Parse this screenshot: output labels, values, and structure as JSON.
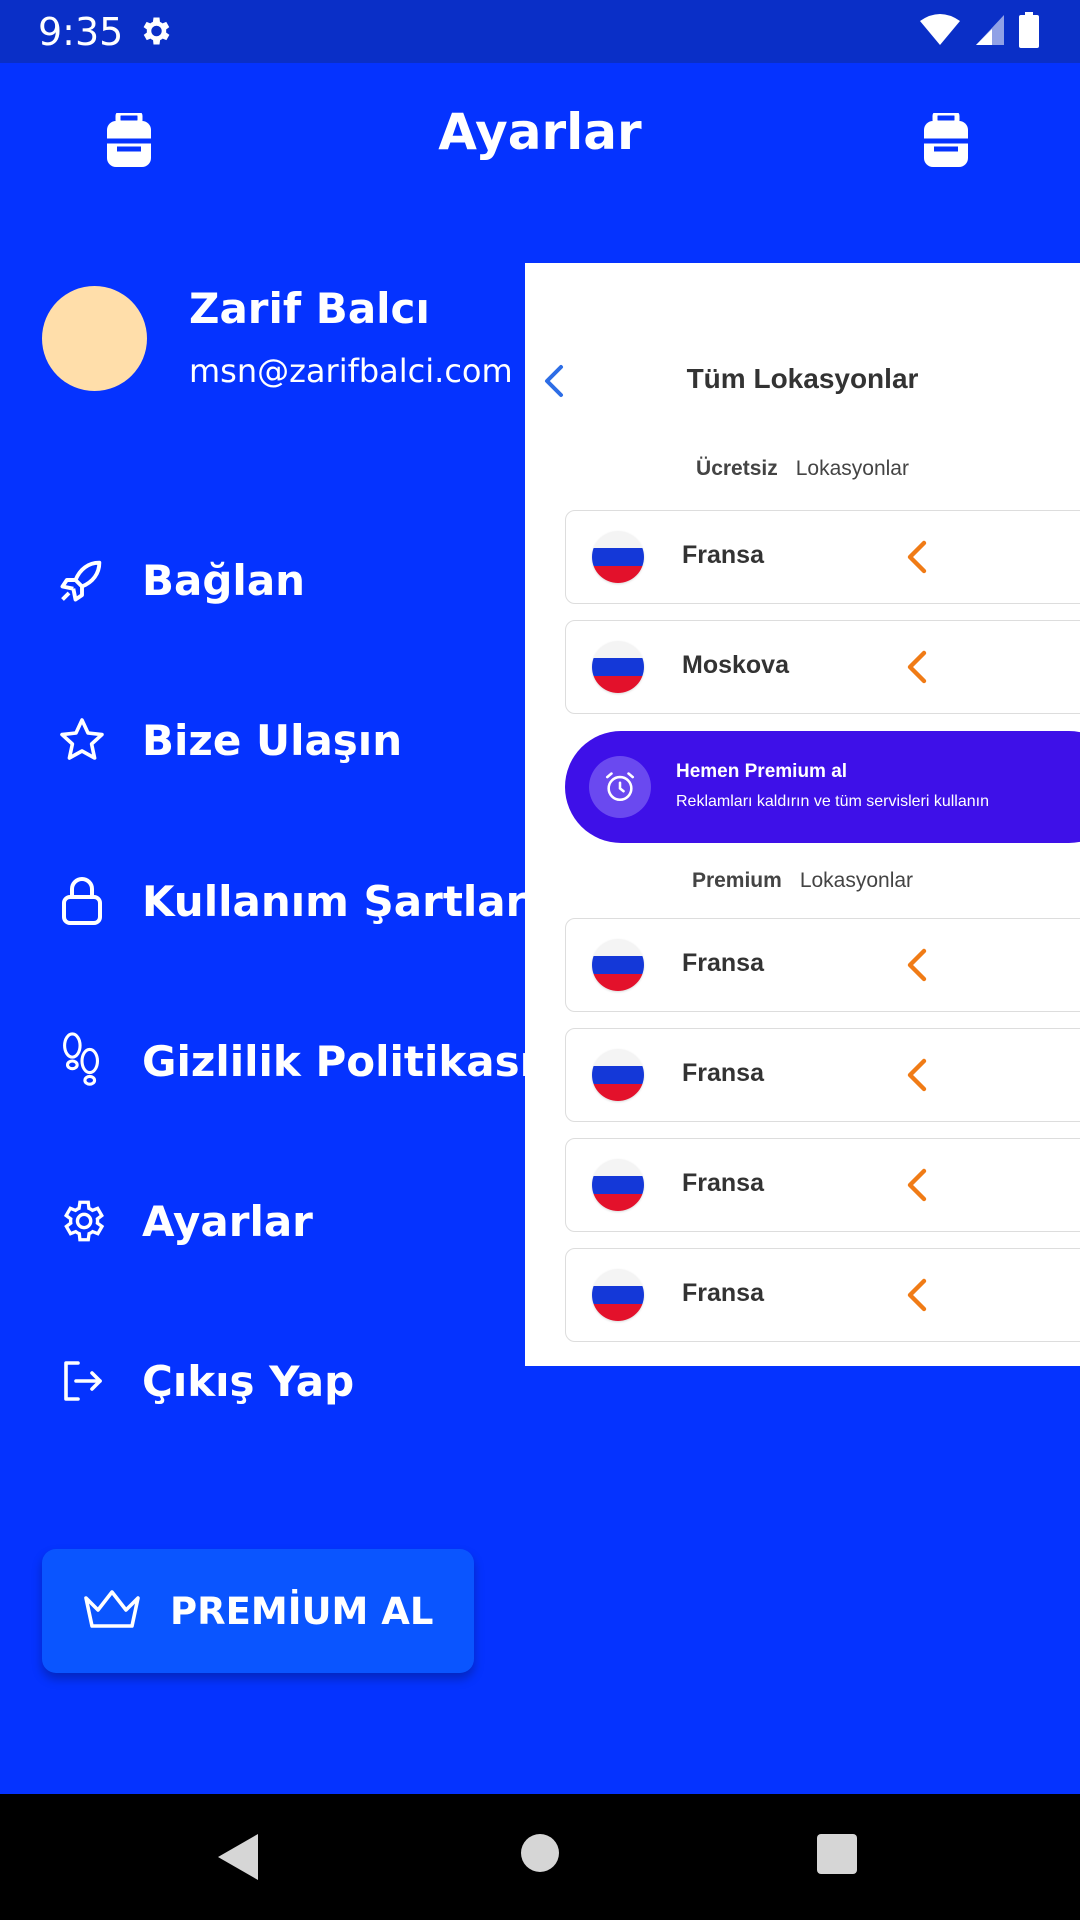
{
  "status_bar": {
    "time": "9:35",
    "icons": [
      "gear-icon",
      "wifi-icon",
      "signal-icon",
      "battery-icon"
    ]
  },
  "topbar": {
    "title": "Ayarlar",
    "left_icon": "backpack-icon",
    "right_icon": "backpack-icon"
  },
  "profile": {
    "name": "Zarif Balcı",
    "email": "msn@zarifbalci.com",
    "avatar_color": "#ffdeaa"
  },
  "menu": [
    {
      "label": "Bağlan",
      "icon": "rocket-icon"
    },
    {
      "label": "Bize Ulaşın",
      "icon": "star-icon"
    },
    {
      "label": "Kullanım Şartları",
      "icon": "lock-icon"
    },
    {
      "label": "Gizlilik Politikası",
      "icon": "footprints-icon"
    },
    {
      "label": "Ayarlar",
      "icon": "settings-icon"
    },
    {
      "label": "Çıkış Yap",
      "icon": "logout-icon"
    }
  ],
  "premium_button": {
    "label": "PREMİUM AL",
    "icon": "crown-icon"
  },
  "panel": {
    "title": "Tüm Lokasyonlar",
    "free_section": {
      "bold": "Ücretsiz",
      "rest": "Lokasyonlar"
    },
    "free_locations": [
      "Fransa",
      "Moskova"
    ],
    "promo": {
      "title": "Hemen Premium al",
      "subtitle": "Reklamları kaldırın ve tüm servisleri kullanın"
    },
    "premium_section": {
      "bold": "Premium",
      "rest": "Lokasyonlar"
    },
    "premium_locations": [
      "Fransa",
      "Fransa",
      "Fransa",
      "Fransa"
    ]
  },
  "colors": {
    "background": "#0533ff",
    "statusbar": "#0a2fc7",
    "accent_orange": "#f07b16",
    "promo": "#3e10e8",
    "premium_button": "#0a55ff"
  }
}
